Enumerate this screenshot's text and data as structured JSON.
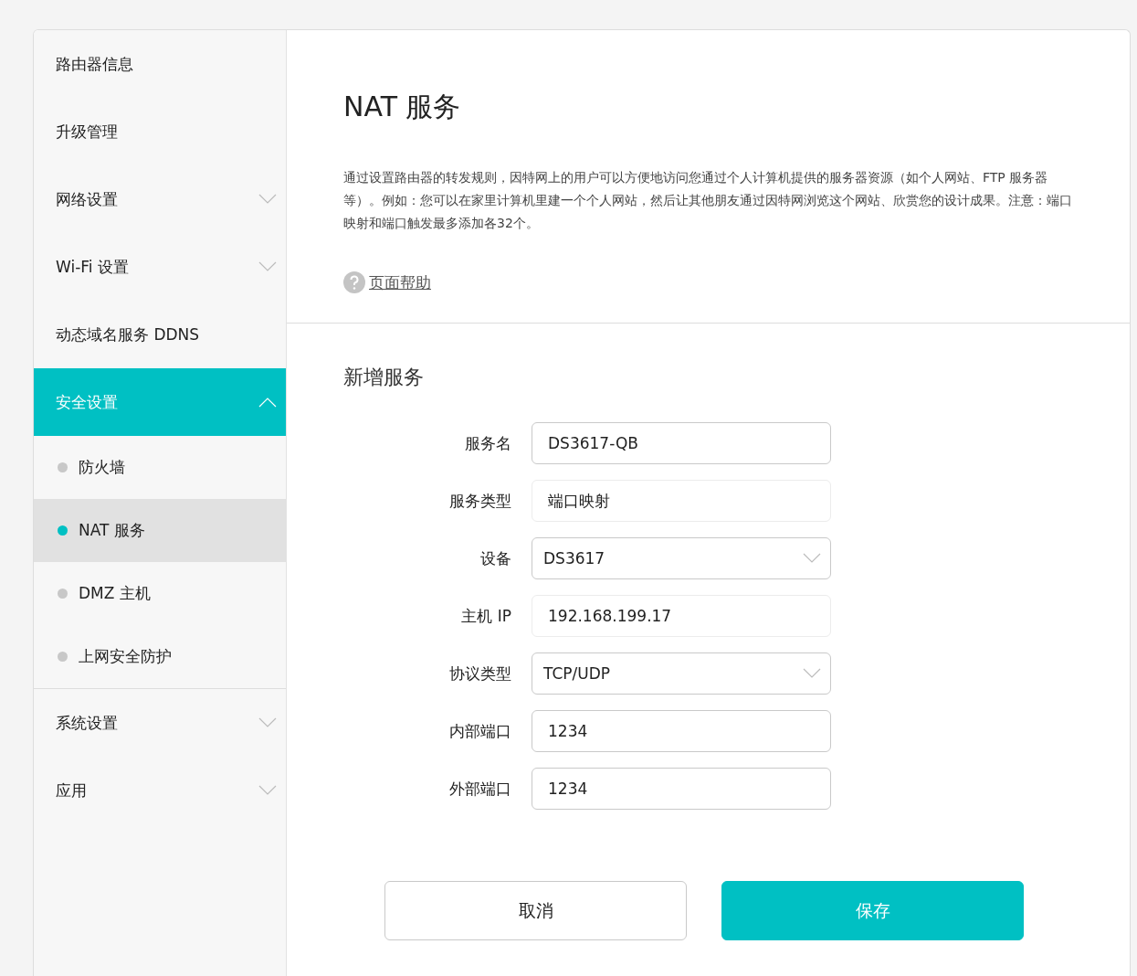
{
  "sidebar": {
    "items": [
      {
        "label": "路由器信息",
        "selected": false
      },
      {
        "label": "升级管理",
        "selected": false
      },
      {
        "label": "网络设置",
        "selected": false,
        "expanded": false
      },
      {
        "label": "Wi-Fi 设置",
        "selected": false,
        "expanded": false
      },
      {
        "label": "动态域名服务 DDNS",
        "selected": false
      },
      {
        "label": "安全设置",
        "selected": true,
        "expanded": true,
        "children": [
          {
            "label": "防火墙",
            "selected": false
          },
          {
            "label": "NAT 服务",
            "selected": true
          },
          {
            "label": "DMZ 主机",
            "selected": false
          },
          {
            "label": "上网安全防护",
            "selected": false
          }
        ]
      },
      {
        "label": "系统设置",
        "selected": false,
        "expanded": false
      },
      {
        "label": "应用",
        "selected": false,
        "expanded": false
      }
    ]
  },
  "page": {
    "title": "NAT 服务",
    "description": "通过设置路由器的转发规则，因特网上的用户可以方便地访问您通过个人计算机提供的服务器资源（如个人网站、FTP 服务器等）。例如：您可以在家里计算机里建一个个人网站，然后让其他朋友通过因特网浏览这个网站、欣赏您的设计成果。注意：端口映射和端口触发最多添加各32个。",
    "help_link": "页面帮助"
  },
  "form": {
    "title": "新增服务",
    "fields": [
      {
        "label": "服务名",
        "kind": "input",
        "value": "DS3617-QB",
        "disabled": false
      },
      {
        "label": "服务类型",
        "kind": "input",
        "value": "端口映射",
        "disabled": true
      },
      {
        "label": "设备",
        "kind": "select",
        "value": "DS3617",
        "disabled": false
      },
      {
        "label": "主机 IP",
        "kind": "input",
        "value": "192.168.199.17",
        "disabled": true
      },
      {
        "label": "协议类型",
        "kind": "select",
        "value": "TCP/UDP",
        "disabled": false
      },
      {
        "label": "内部端口",
        "kind": "input",
        "value": "1234",
        "disabled": false
      },
      {
        "label": "外部端口",
        "kind": "input",
        "value": "1234",
        "disabled": false
      }
    ],
    "buttons": [
      {
        "label": "取消",
        "kind": "secondary"
      },
      {
        "label": "保存",
        "kind": "primary"
      }
    ]
  }
}
